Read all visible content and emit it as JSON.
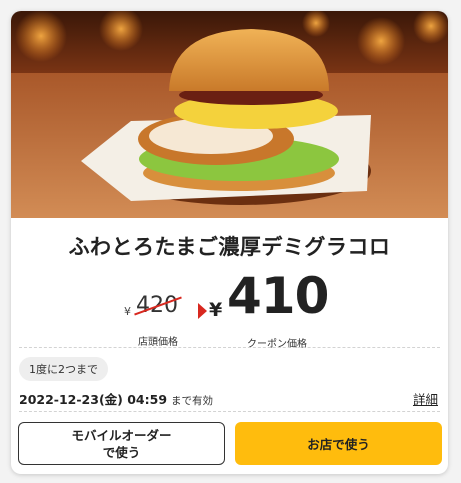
{
  "coupon": {
    "product_name": "ふわとろたまご濃厚デミグラコロ",
    "original_price": {
      "currency": "¥",
      "value": "420",
      "caption": "店頭価格"
    },
    "coupon_price": {
      "currency": "¥",
      "value": "410",
      "caption": "クーポン価格"
    },
    "usage_limit": "1度に2つまで",
    "expiry": {
      "date": "2022-12-23(金) 04:59",
      "note": "まで有効"
    },
    "detail_link": "詳細"
  },
  "actions": {
    "mobile_order_line1": "モバイルオーダー",
    "mobile_order_line2": "で使う",
    "use_in_store": "お店で使う"
  },
  "colors": {
    "accent_yellow": "#ffbc0d",
    "strike_red": "#d8281f",
    "text": "#222222"
  },
  "icons": {
    "price_arrow": "red-triangle-right-icon"
  }
}
